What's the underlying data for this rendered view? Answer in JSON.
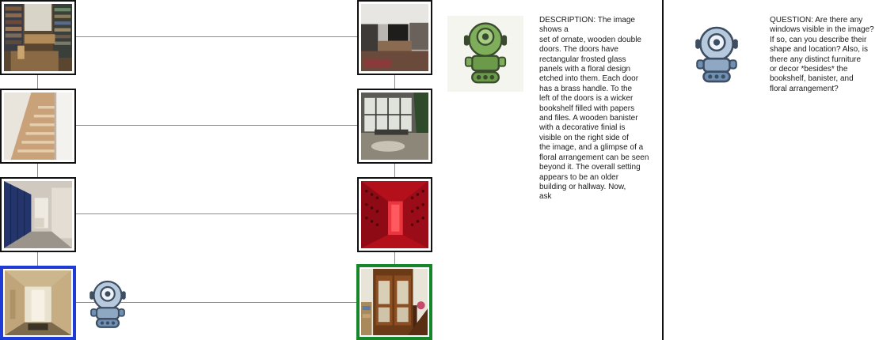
{
  "left_column": {
    "images": [
      {
        "name": "library-room"
      },
      {
        "name": "staircase"
      },
      {
        "name": "locker-hallway"
      },
      {
        "name": "narrow-corridor"
      }
    ]
  },
  "right_column": {
    "images": [
      {
        "name": "living-room"
      },
      {
        "name": "sunroom-windows"
      },
      {
        "name": "red-wine-cellar"
      },
      {
        "name": "wooden-double-doors"
      }
    ]
  },
  "colors": {
    "selected_left": "#1f3bd6",
    "selected_right": "#17852a",
    "robot_green": "#6a9a4a",
    "robot_blue": "#6f8fb3"
  },
  "description_panel": {
    "icon": "green-robot-icon",
    "text": "DESCRIPTION: The image shows a\nset of ornate, wooden double\ndoors. The doors have\nrectangular frosted glass\npanels with a floral design\netched into them. Each door\nhas a brass handle. To the\nleft of the doors is a wicker\nbookshelf filled with papers\nand files. A wooden banister\nwith a decorative finial is\nvisible on the right side of\nthe image, and a glimpse of a\nfloral arrangement can be seen\nbeyond it. The overall setting\nappears to be an older\nbuilding or hallway.    Now,\nask"
  },
  "question_panel": {
    "icon": "blue-robot-icon",
    "text": "QUESTION: Are there any\nwindows visible in the image?\nIf so, can you describe their\nshape and location? Also, is\nthere any distinct furniture\nor decor *besides* the\nbookshelf, banister, and\nfloral arrangement?"
  }
}
